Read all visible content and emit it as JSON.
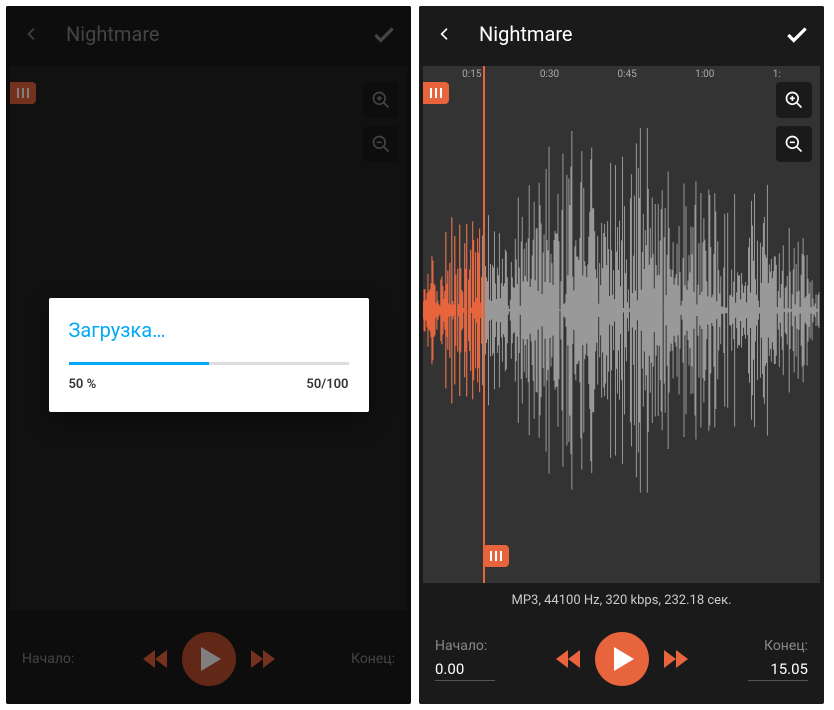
{
  "left": {
    "header": {
      "title": "Nightmare"
    },
    "footer": {
      "start_label": "Начало:",
      "end_label": "Конец:"
    },
    "dialog": {
      "title": "Загрузка…",
      "percent_text": "50 %",
      "count_text": "50/100",
      "progress_pct": 50
    }
  },
  "right": {
    "header": {
      "title": "Nightmare"
    },
    "timeline": [
      "0:15",
      "0:30",
      "0:45",
      "1:00",
      "1:"
    ],
    "file_info": "MP3, 44100 Hz, 320 kbps, 232.18 сек.",
    "footer": {
      "start_label": "Начало:",
      "start_value": "0.00",
      "end_label": "Конец:",
      "end_value": "15.05"
    }
  },
  "colors": {
    "accent": "#e8643c",
    "dialog_accent": "#03A9F4"
  }
}
